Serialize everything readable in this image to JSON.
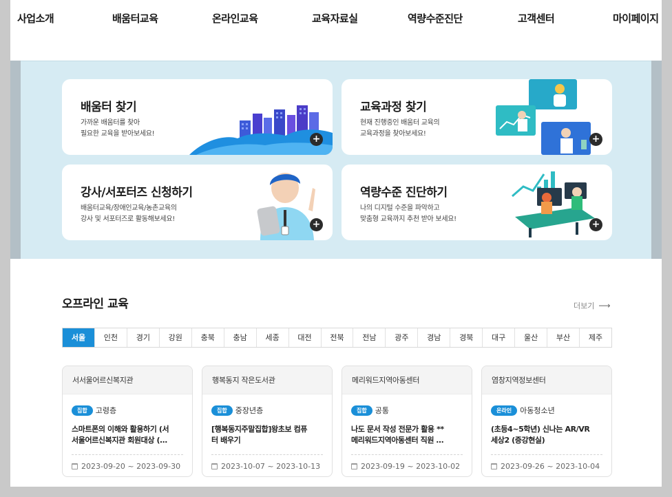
{
  "nav": {
    "items": [
      "사업소개",
      "배움터교육",
      "온라인교육",
      "교육자료실",
      "역량수준진단",
      "고객센터",
      "마이페이지"
    ]
  },
  "quick_menu": [
    {
      "title": "배움터 찾기",
      "desc1": "가까운 배움터를 찾아",
      "desc2": "필요한 교육을 받아보세요!"
    },
    {
      "title": "교육과정 찾기",
      "desc1": "현재 진행중인 배움터 교육의",
      "desc2": "교육과정을 찾아보세요!"
    },
    {
      "title": "강사/서포터즈 신청하기",
      "desc1": "배움터교육/장애인교육/농촌교육의",
      "desc2": "강사 및 서포터즈로 활동해보세요!"
    },
    {
      "title": "역량수준 진단하기",
      "desc1": "나의 디지털 수준을 파악하고",
      "desc2": "맞춤형 교육까지 추천 받아 보세요!"
    }
  ],
  "plus_label": "+",
  "offline": {
    "title": "오프라인 교육",
    "more": "더보기",
    "more_arrow": "⟶",
    "regions": [
      "서울",
      "인천",
      "경기",
      "강원",
      "충북",
      "충남",
      "세종",
      "대전",
      "전북",
      "전남",
      "광주",
      "경남",
      "경북",
      "대구",
      "울산",
      "부산",
      "제주"
    ],
    "active_region": "서울",
    "courses": [
      {
        "center": "서서울어르신복지관",
        "type": "집합",
        "target": "고령층",
        "title1": "스마트폰의 이해와 활용하기 (서",
        "title2": "서울어르신복지관 회원대상 (…",
        "date": "2023-09-20 ~ 2023-09-30"
      },
      {
        "center": "행복동지 작은도서관",
        "type": "집합",
        "target": "중장년층",
        "title1": "[행복동지주말집합]왕초보 컴퓨",
        "title2": "터 배우기",
        "date": "2023-10-07 ~ 2023-10-13"
      },
      {
        "center": "메리워드지역아동센터",
        "type": "집합",
        "target": "공통",
        "title1": "나도 문서 작성 전문가 활용 **",
        "title2": "메리워드지역아동센터 직원 …",
        "date": "2023-09-19 ~ 2023-10-02"
      },
      {
        "center": "염창지역정보센터",
        "type": "온라인",
        "target": "아동청소년",
        "title1": "(초등4~5학년) 신나는 AR/VR",
        "title2": "세상2 (증강현실)",
        "date": "2023-09-26 ~ 2023-10-04"
      }
    ]
  },
  "colors": {
    "accent": "#1a8fd8",
    "band": "#d6ebf3",
    "dark_button": "#2b2b2b"
  }
}
